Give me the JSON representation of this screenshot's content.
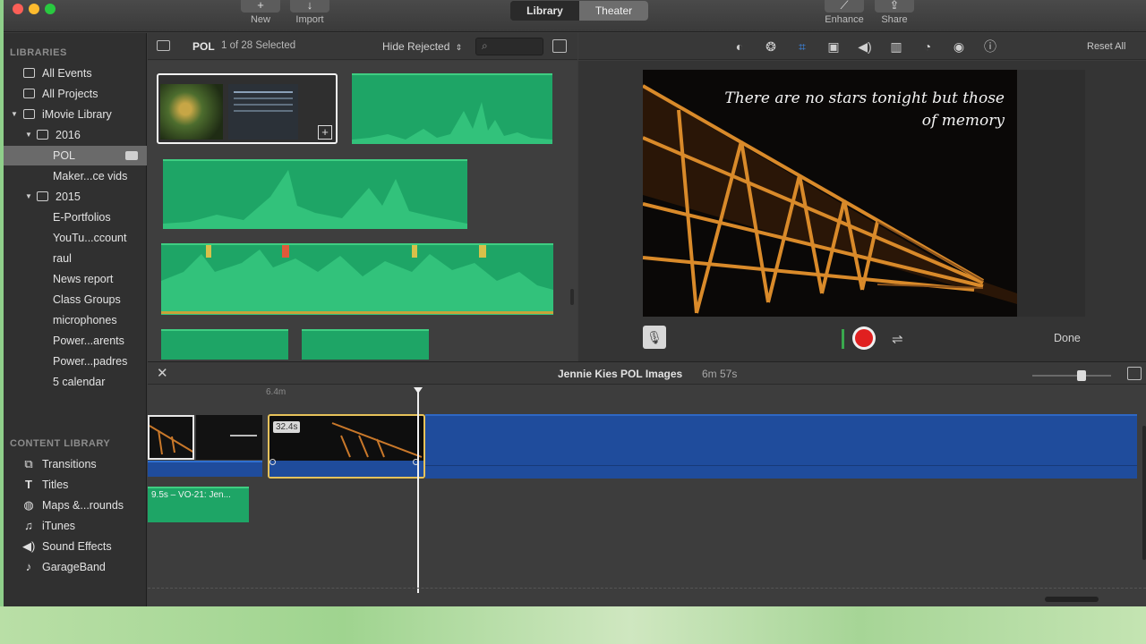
{
  "toolbar": {
    "new_label": "New",
    "import_label": "Import",
    "library_tab": "Library",
    "theater_tab": "Theater",
    "enhance_label": "Enhance",
    "share_label": "Share"
  },
  "sidebar": {
    "libraries_heading": "LIBRARIES",
    "items": [
      {
        "label": "All Events"
      },
      {
        "label": "All Projects"
      },
      {
        "label": "iMovie Library"
      },
      {
        "label": "2016"
      },
      {
        "label": "POL"
      },
      {
        "label": "Maker...ce vids"
      },
      {
        "label": "2015"
      },
      {
        "label": "E-Portfolios"
      },
      {
        "label": "YouTu...ccount"
      },
      {
        "label": "raul"
      },
      {
        "label": "News report"
      },
      {
        "label": "Class Groups"
      },
      {
        "label": "microphones"
      },
      {
        "label": "Power...arents"
      },
      {
        "label": "Power...padres"
      },
      {
        "label": "5 calendar"
      }
    ],
    "content_heading": "CONTENT LIBRARY",
    "content_items": [
      {
        "label": "Transitions"
      },
      {
        "label": "Titles"
      },
      {
        "label": "Maps &...rounds"
      },
      {
        "label": "iTunes"
      },
      {
        "label": "Sound Effects"
      },
      {
        "label": "GarageBand"
      }
    ]
  },
  "browser": {
    "event_name": "POL",
    "selection_count": "1 of 28 Selected",
    "filter_label": "Hide Rejected"
  },
  "viewer": {
    "reset_all": "Reset All",
    "caption_line1": "There are no stars tonight but those",
    "caption_line2": "of memory",
    "done_label": "Done"
  },
  "timeline": {
    "project_title": "Jennie Kies POL Images",
    "project_duration": "6m 57s",
    "ruler_mark": "6.4m",
    "selected_clip_duration": "32.4s",
    "audio_clip_label": "9.5s – VO-21: Jen..."
  },
  "colors": {
    "accent_record": "#e02020",
    "selection_yellow": "#e6c25a",
    "timeline_blue": "#1f4c9c",
    "audio_green": "#1ea566"
  }
}
